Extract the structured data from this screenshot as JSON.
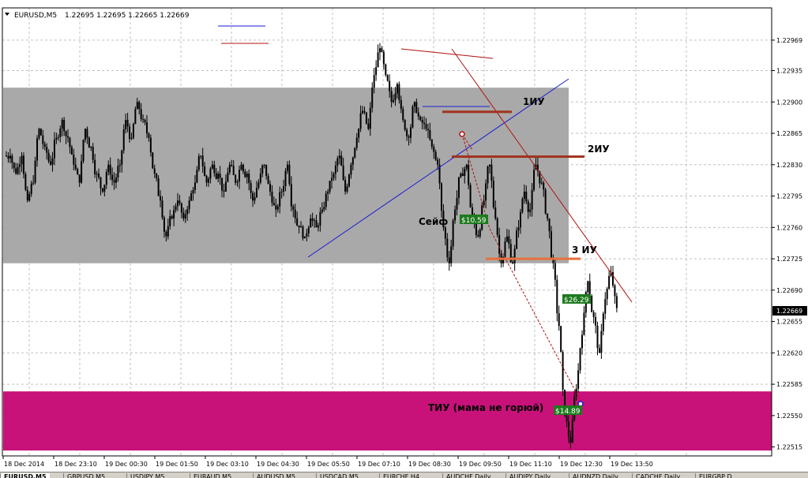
{
  "symbol_header": "EURUSD,M5",
  "ohlc_header": "1.22695 1.22695 1.22665 1.22669",
  "current_price": "1.22669",
  "colors": {
    "grid": "#c0c0c0",
    "gray_zone": "#a9a9a9",
    "magenta_zone": "#c8127a",
    "level_red": "#a0321e",
    "level_orange": "#e8703c",
    "trend_blue": "#1a1ad4",
    "trend_red": "#b01010",
    "label_green": "#1e7a1e",
    "candle": "#000000"
  },
  "chart_data": {
    "type": "candlestick",
    "y_ticks": [
      "1.22969",
      "1.22935",
      "1.22900",
      "1.22865",
      "1.22830",
      "1.22795",
      "1.22760",
      "1.22725",
      "1.22690",
      "1.22655",
      "1.22620",
      "1.22585",
      "1.22550",
      "1.22515"
    ],
    "ylim": [
      1.22505,
      1.23005
    ],
    "x_ticks": [
      "18 Dec 2014",
      "18 Dec 23:10",
      "19 Dec 00:30",
      "19 Dec 01:50",
      "19 Dec 03:10",
      "19 Dec 04:30",
      "19 Dec 05:50",
      "19 Dec 07:10",
      "19 Dec 08:30",
      "19 Dec 09:50",
      "19 Dec 11:10",
      "19 Dec 12:30",
      "19 Dec 13:50"
    ],
    "close_path": [
      1.2284,
      1.2282,
      1.2284,
      1.2279,
      1.2281,
      1.2287,
      1.2285,
      1.2283,
      1.2286,
      1.2288,
      1.2286,
      1.2283,
      1.2281,
      1.2287,
      1.2285,
      1.2282,
      1.228,
      1.2283,
      1.2281,
      1.2283,
      1.2288,
      1.2286,
      1.229,
      1.2288,
      1.2286,
      1.2282,
      1.2279,
      1.2275,
      1.2277,
      1.2279,
      1.2277,
      1.2279,
      1.2281,
      1.2284,
      1.2281,
      1.2283,
      1.2282,
      1.228,
      1.2283,
      1.2281,
      1.2283,
      1.2282,
      1.2279,
      1.2281,
      1.2283,
      1.228,
      1.2278,
      1.228,
      1.2283,
      1.2278,
      1.2276,
      1.2275,
      1.2277,
      1.2276,
      1.2278,
      1.228,
      1.2282,
      1.2284,
      1.228,
      1.2283,
      1.2286,
      1.2289,
      1.2287,
      1.2293,
      1.2296,
      1.2293,
      1.229,
      1.2292,
      1.2288,
      1.2286,
      1.229,
      1.2288,
      1.2287,
      1.2285,
      1.2283,
      1.2276,
      1.2272,
      1.2278,
      1.2282,
      1.2283,
      1.2277,
      1.2275,
      1.2279,
      1.2283,
      1.2277,
      1.2272,
      1.2275,
      1.2272,
      1.2276,
      1.228,
      1.2278,
      1.2283,
      1.2281,
      1.2277,
      1.2272,
      1.2265,
      1.2255,
      1.2252,
      1.2258,
      1.2264,
      1.227,
      1.2266,
      1.2262,
      1.2268,
      1.2271,
      1.2267
    ],
    "gray_zone": {
      "top": 1.22916,
      "bottom": 1.2272
    },
    "magenta_zone": {
      "top": 1.22577,
      "bottom": 1.22511
    },
    "levels": [
      {
        "price": 1.22889,
        "color": "level_red"
      },
      {
        "price": 1.22839,
        "color": "level_red"
      },
      {
        "price": 1.22725,
        "color": "level_orange"
      }
    ],
    "annotations": [
      {
        "text": "1ИУ",
        "name": "label-1iu"
      },
      {
        "text": "2ИУ",
        "name": "label-2iu"
      },
      {
        "text": "3 ИУ",
        "name": "label-3iu"
      },
      {
        "text": "Сейф",
        "name": "label-seif"
      },
      {
        "text": "ТИУ (мама не горюй)",
        "name": "label-tiu"
      }
    ],
    "profit_labels": [
      "$10.59",
      "$26.29",
      "$14.89"
    ]
  },
  "tabs": [
    "EURUSD,M5",
    "GBPUSD,M5",
    "USDJPY,M5",
    "EURAUD,M5",
    "AUDUSD,M5",
    "USDCAD,M5",
    "EURCHF,H4",
    "AUDCHF,Daily",
    "AUDJPY,Daily",
    "AUDNZD,Daily",
    "CADCHF,Daily",
    "EURGBP,D"
  ]
}
